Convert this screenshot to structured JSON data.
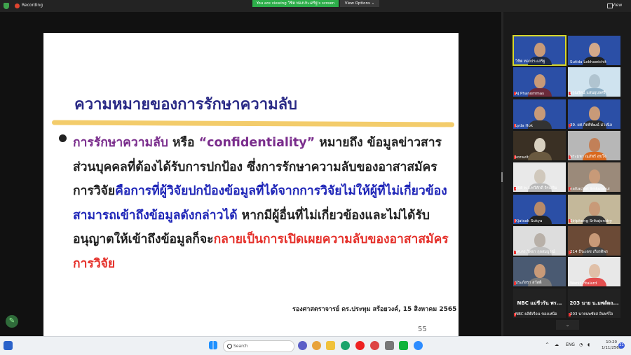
{
  "topbar": {
    "recording_label": "Recording",
    "viewing_banner": "You are viewing วิชิต ทองประเสริฐ's screen",
    "view_options_label": "View Options",
    "view_label": "View"
  },
  "slide": {
    "title": "ความหมายของการรักษาความลับ",
    "segments": {
      "s1": "การรักษาความลับ",
      "s2": " หรือ ",
      "s3": "“confidentiality”",
      "s4": " หมายถึง ข้อมูลข่าวสารส่วนบุคคลที่ต้องได้รับการปกป้อง ซึ่งการรักษาความลับของอาสาสมัครการวิจัย",
      "s5": "คือการที่ผู้วิจัยปกป้องข้อมูลที่ได้จากการวิจัยไม่ให้ผู้ที่ไม่เกี่ยวข้องสามารถเข้าถึงข้อมูลดังกล่าวได้",
      "s6": " หากมีผู้อื่นที่ไม่เกี่ยวข้องและไม่ได้รับอนุญาตให้เข้าถึงข้อมูลก็จะ",
      "s7": "กลายเป็นการเปิดเผยความลับของอาสาสมัครการวิจัย"
    },
    "citation": "รองศาสตราจารย์ ดร.ประทุม สร้อยวงค์, 15 สิงหาคม 2565",
    "page_number": "55"
  },
  "participants": [
    {
      "name": "วิชิต ทองประเสริฐ",
      "kind": "video",
      "bg": "#2b4fa6",
      "skin": "#c89a78",
      "shirt": "#1d2a44",
      "active": true,
      "muted": false
    },
    {
      "name": "Sutida Lekhawichit",
      "kind": "video",
      "bg": "#2b4fa6",
      "skin": "#d4a98a",
      "shirt": "#222",
      "muted": false
    },
    {
      "name": "Aj Phanommas",
      "kind": "video",
      "bg": "#2b4fa6",
      "skin": "#c89a78",
      "shirt": "#6a2a3a",
      "muted": true
    },
    {
      "name": "อรุณรัตน์ แสนอุบลศรี",
      "kind": "video",
      "bg": "#cfe3ef",
      "skin": "#b0c4d0",
      "shirt": "#8fb0c6",
      "muted": true
    },
    {
      "name": "Lyda Hok",
      "kind": "video",
      "bg": "#2b4fa6",
      "skin": "#c89a78",
      "shirt": "#333",
      "muted": true
    },
    {
      "name": "39. ผศ.กิตติพัฒน์ ม่วงนิล",
      "kind": "video",
      "bg": "#2b4fa6",
      "skin": "#c89a78",
      "shirt": "#2a2a2a",
      "muted": true
    },
    {
      "name": "koravit",
      "kind": "video",
      "bg": "#3a3024",
      "skin": "#d8d0c0",
      "shirt": "#6a5a40",
      "muted": true
    },
    {
      "name": "พระมหา ณภัทร์ สุขใจ",
      "kind": "video",
      "bg": "#b7b7b7",
      "skin": "#c28058",
      "shirt": "#d9691e",
      "muted": true
    },
    {
      "name": "208 พ.อ.ทวีศักดิ์ จิรเสริม",
      "kind": "video",
      "bg": "#e9e9e9",
      "skin": "#d0c8bc",
      "shirt": "#b9b9b9",
      "muted": true
    },
    {
      "name": "nattachet limkulanui",
      "kind": "video",
      "bg": "#9b8a7a",
      "skin": "#c89a78",
      "shirt": "#eee",
      "muted": true
    },
    {
      "name": "Kjatsak Sukya",
      "kind": "video",
      "bg": "#2b4fa6",
      "skin": "#b88a68",
      "shirt": "#222",
      "muted": true
    },
    {
      "name": "Siriphong Srikajonsiry",
      "kind": "video",
      "bg": "#c4b89a",
      "skin": "#c89a78",
      "shirt": "#333",
      "muted": true
    },
    {
      "name": "รศ.ดร.วิทยา กุลสมบูรณ์",
      "kind": "video",
      "bg": "#ddd",
      "skin": "#b8b0a8",
      "shirt": "#c0c0c0",
      "muted": true
    },
    {
      "name": "214 ธีระเดช เกียรติพร",
      "kind": "video",
      "bg": "#6b4a36",
      "skin": "#c89a78",
      "shirt": "#444",
      "muted": true
    },
    {
      "name": "ประภัสรา สวัสดี",
      "kind": "video",
      "bg": "#4a5a72",
      "skin": "#c89a78",
      "shirt": "#7a7a7a",
      "muted": true
    },
    {
      "name": "Wanit Pitalard",
      "kind": "video",
      "bg": "#e8e8e8",
      "skin": "#e0c0a8",
      "shirt": "#e34f4f",
      "muted": false
    },
    {
      "name": "NBC ผลิตีเรือน ของเหนือ",
      "bigname": "NBC แม่ชีวรัน พร...",
      "kind": "name",
      "muted": true
    },
    {
      "name": "203 นายนพชัยส อินทร์ใจ",
      "bigname": "203 นาย น.มพลัดถ...",
      "kind": "name",
      "muted": true
    }
  ],
  "taskbar": {
    "search_placeholder": "Search",
    "language": "ENG",
    "time": "10:20",
    "date": "1/11/2566",
    "notification_count": "21"
  }
}
